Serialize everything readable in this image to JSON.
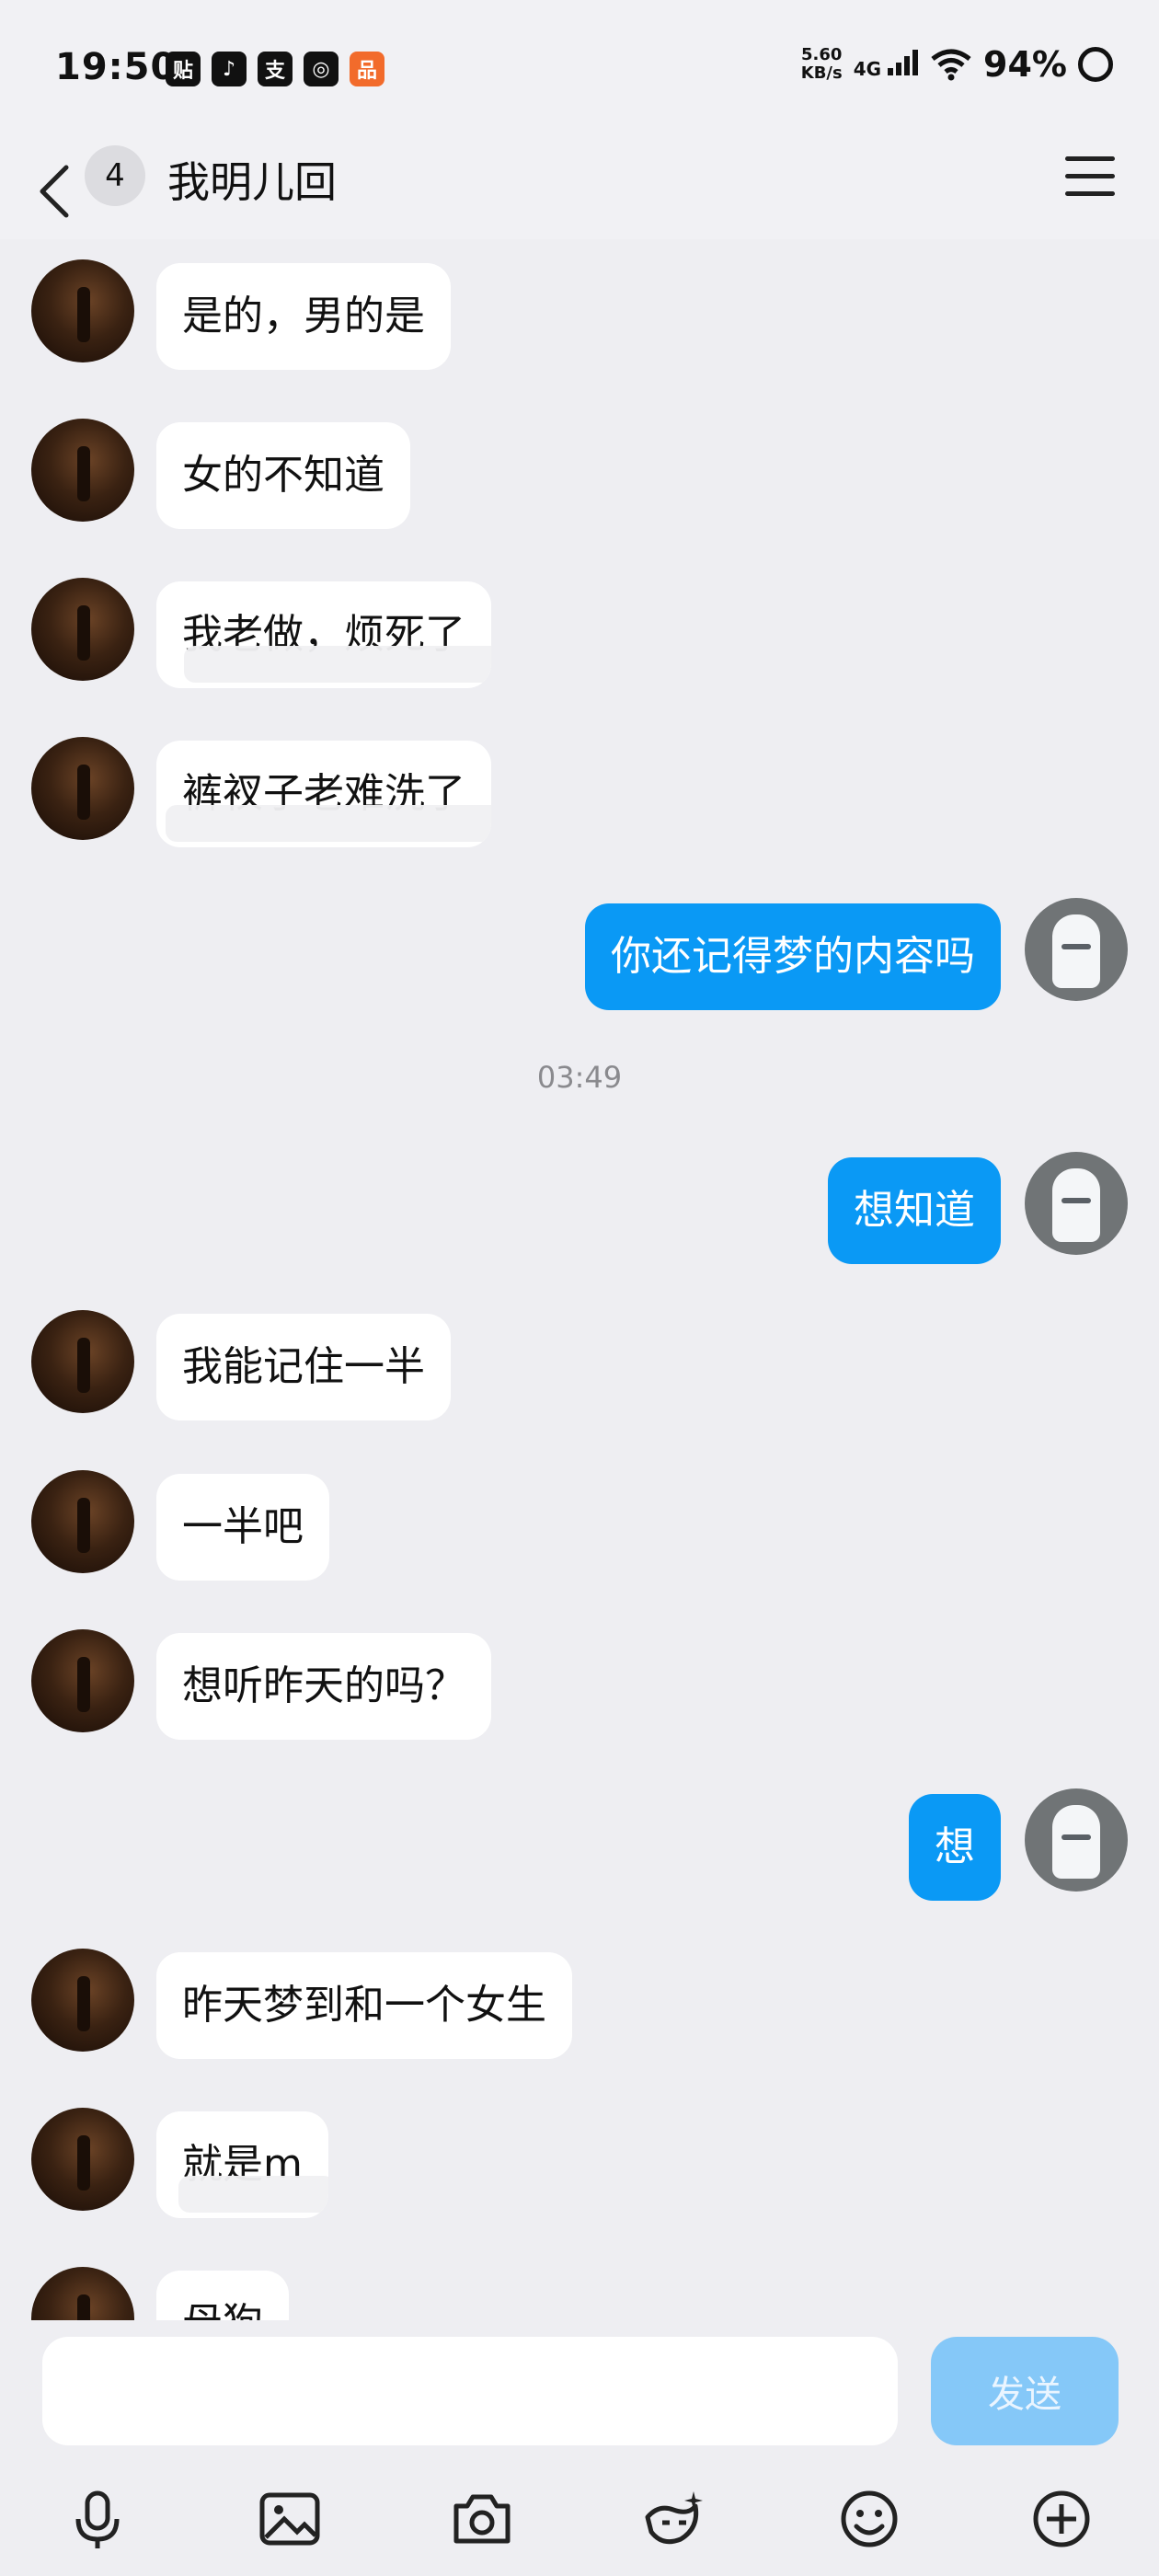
{
  "status": {
    "time": "19:50",
    "apps": [
      "贴",
      "♪",
      "支",
      "◎",
      "品"
    ],
    "speed_value": "5.60",
    "speed_unit": "KB/s",
    "network": "4G",
    "battery": "94%"
  },
  "header": {
    "unread_count": "4",
    "title": "我明儿回"
  },
  "messages": [
    {
      "side": "in",
      "text": "是的，男的是"
    },
    {
      "side": "in",
      "text": "女的不知道"
    },
    {
      "side": "in",
      "text": "我老做，烦死了"
    },
    {
      "side": "in",
      "text": "裤衩子老难洗了"
    },
    {
      "side": "out",
      "text": "你还记得梦的内容吗"
    },
    {
      "side": "time",
      "text": "03:49"
    },
    {
      "side": "out",
      "text": "想知道"
    },
    {
      "side": "in",
      "text": "我能记住一半"
    },
    {
      "side": "in",
      "text": "一半吧"
    },
    {
      "side": "in",
      "text": "想听昨天的吗？"
    },
    {
      "side": "out",
      "text": "想"
    },
    {
      "side": "in",
      "text": "昨天梦到和一个女生"
    },
    {
      "side": "in",
      "text": "就是m"
    },
    {
      "side": "in",
      "text": "母狗"
    }
  ],
  "composer": {
    "placeholder": "",
    "send_label": "发送"
  },
  "toolbar": [
    "microphone-icon",
    "image-icon",
    "camera-icon",
    "sticker-icon",
    "emoji-icon",
    "plus-icon"
  ],
  "colors": {
    "accent": "#0a99f5",
    "send_disabled": "#85c8f8",
    "background": "#eeeef2"
  }
}
